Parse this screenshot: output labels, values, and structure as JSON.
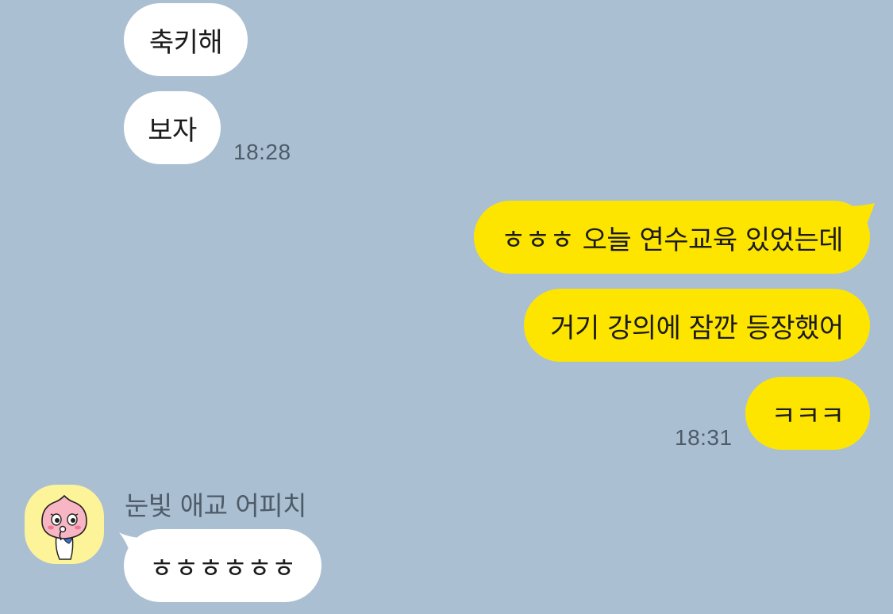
{
  "messages": [
    {
      "direction": "incoming",
      "text": "축키해"
    },
    {
      "direction": "incoming",
      "text": "보자",
      "time": "18:28"
    },
    {
      "direction": "outgoing",
      "text": "ㅎㅎㅎ 오늘 연수교육 있었는데"
    },
    {
      "direction": "outgoing",
      "text": "거기 강의에 잠깐 등장했어"
    },
    {
      "direction": "outgoing",
      "text": "ㅋㅋㅋ",
      "time": "18:31"
    },
    {
      "direction": "incoming",
      "sender": "눈빛 애교 어피치",
      "text": "ㅎㅎㅎㅎㅎㅎ",
      "avatar_icon": "apeach-character-icon"
    }
  ],
  "colors": {
    "background": "#abbfd3",
    "incoming_bubble": "#ffffff",
    "outgoing_bubble": "#fee500",
    "avatar_background": "#fdf49a",
    "meta_text": "#4e5b68"
  }
}
